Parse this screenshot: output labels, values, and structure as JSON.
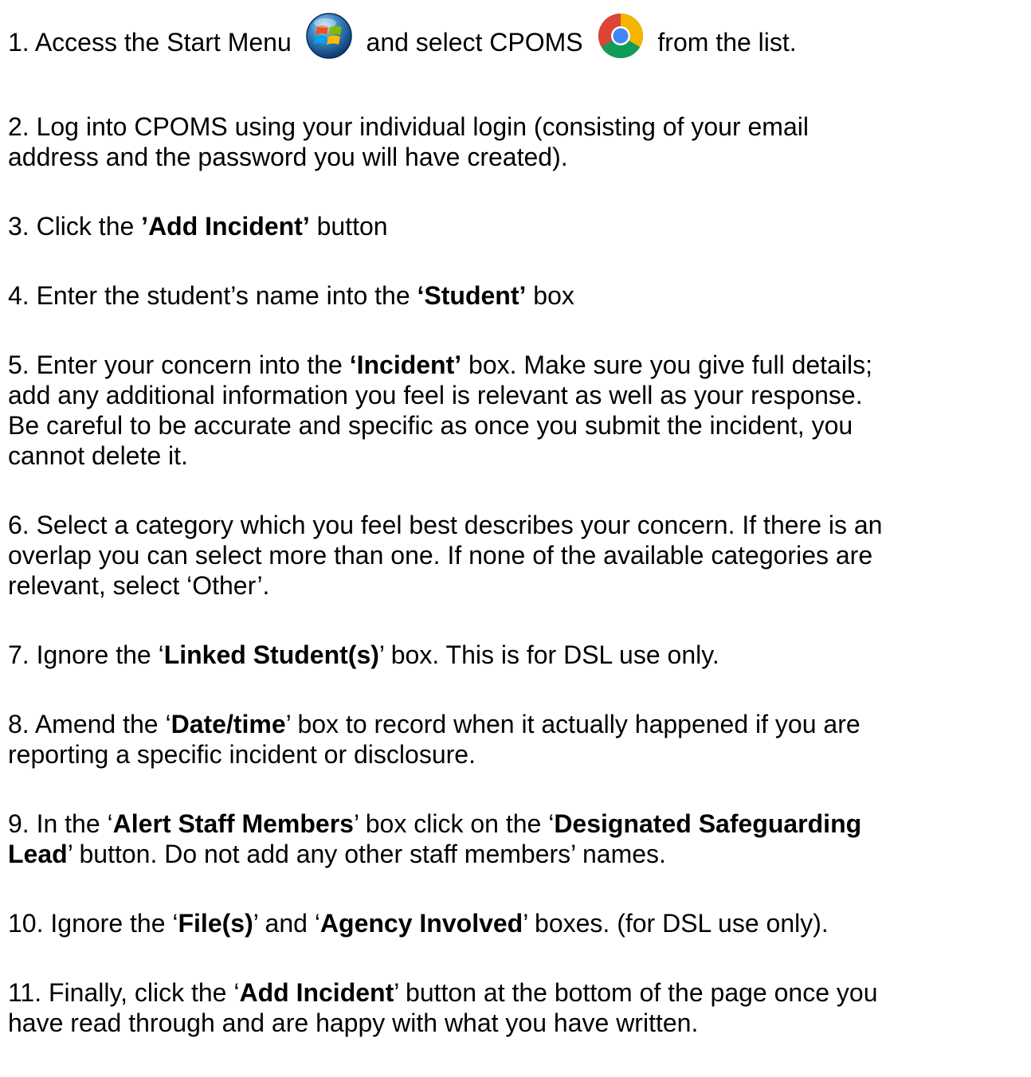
{
  "steps": {
    "s1": {
      "part1": "1. Access the Start Menu",
      "icon1": "windows-start-orb-icon",
      "part2": "and select CPOMS",
      "icon2": "chrome-icon",
      "part3": "from the list."
    },
    "s2": {
      "line1": "2. Log into CPOMS using your individual login (consisting of your email",
      "line2": "address and the password you will have created)."
    },
    "s3": {
      "pre": "3. Click the ",
      "bold": "’Add Incident’",
      "post": " button"
    },
    "s4": {
      "pre": "4. Enter the student’s name into the ",
      "bold": "‘Student’",
      "post": " box"
    },
    "s5": {
      "l1_pre": "5. Enter your concern into the ",
      "l1_bold": "‘Incident’",
      "l1_post": " box. Make sure you give full details;",
      "line2": "add any additional information you feel is relevant as well as your response.",
      "line3": "Be careful to be accurate and specific as once you submit the incident, you",
      "line4": "cannot delete it."
    },
    "s6": {
      "line1": "6. Select a category which you feel best describes your concern. If there is an",
      "line2": "overlap you can select more than one. If none of the available categories are",
      "line3": "relevant, select ‘Other’."
    },
    "s7": {
      "pre": "7. Ignore the ‘",
      "bold": "Linked Student(s)",
      "post": "’ box. This is for DSL use only."
    },
    "s8": {
      "l1_pre": "8. Amend the ‘",
      "l1_bold": "Date/time",
      "l1_post": "’ box to record when it actually happened if you are",
      "line2": "reporting a specific incident or disclosure."
    },
    "s9": {
      "l1_pre": "9. In the ‘",
      "l1_bold1": "Alert Staff Members",
      "l1_mid": "’ box click on the ‘",
      "l1_bold2": "Designated Safeguarding",
      "l2_bold": "Lead",
      "l2_post": "’ button. Do not add any other staff members’ names."
    },
    "s10": {
      "pre": "10. Ignore the ‘",
      "bold1": "File(s)",
      "mid": "’ and ‘",
      "bold2": "Agency Involved",
      "post": "’ boxes. (for DSL use only)."
    },
    "s11": {
      "l1_pre": "11. Finally, click the ‘",
      "l1_bold": "Add Incident",
      "l1_post": "’ button at the bottom of the page once you",
      "line2": "have read through and are happy with what you have written."
    }
  }
}
